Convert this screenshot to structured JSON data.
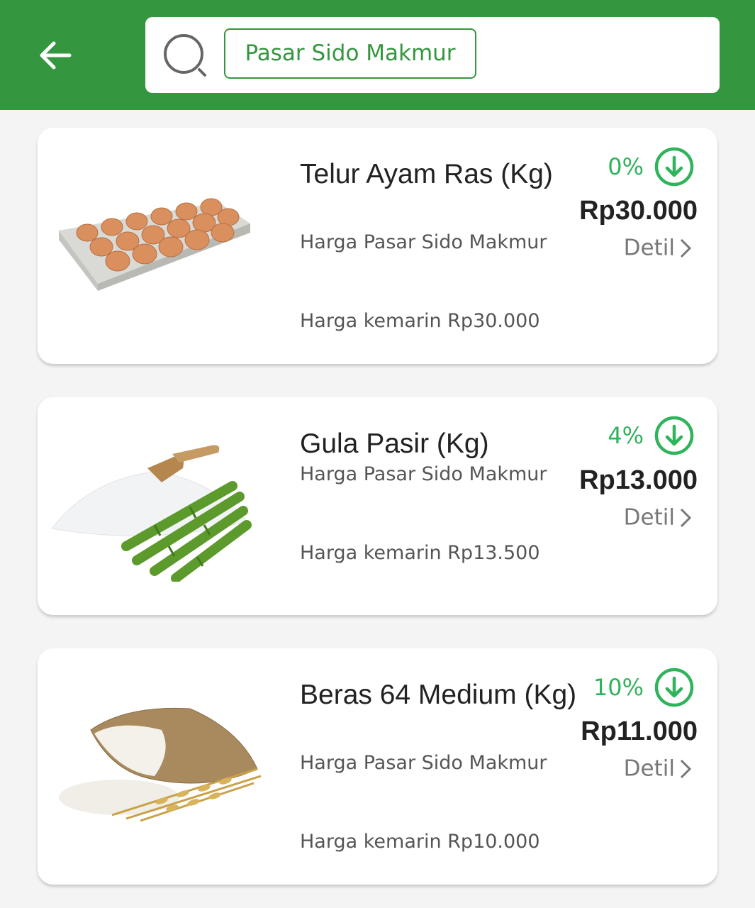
{
  "header": {
    "back_label": "",
    "search_chip": "Pasar Sido Makmur"
  },
  "colors": {
    "brand_green": "#34963f",
    "percent_green": "#2fb35b"
  },
  "icons": [
    "arrow-left-icon",
    "search-icon",
    "arrow-down-circle-icon",
    "chevron-right-icon"
  ],
  "products": [
    {
      "name": "Telur Ayam Ras (Kg)",
      "market_label": "Harga Pasar Sido Makmur",
      "change_percent": "0%",
      "price": "Rp30.000",
      "detail_label": "Detil",
      "yesterday": "Harga kemarin Rp30.000"
    },
    {
      "name": "Gula Pasir (Kg)",
      "market_label": "Harga Pasar Sido Makmur",
      "change_percent": "4%",
      "price": "Rp13.000",
      "detail_label": "Detil",
      "yesterday": "Harga kemarin Rp13.500"
    },
    {
      "name": "Beras 64 Medium (Kg)",
      "market_label": "Harga Pasar Sido Makmur",
      "change_percent": "10%",
      "price": "Rp11.000",
      "detail_label": "Detil",
      "yesterday": "Harga kemarin Rp10.000"
    }
  ]
}
